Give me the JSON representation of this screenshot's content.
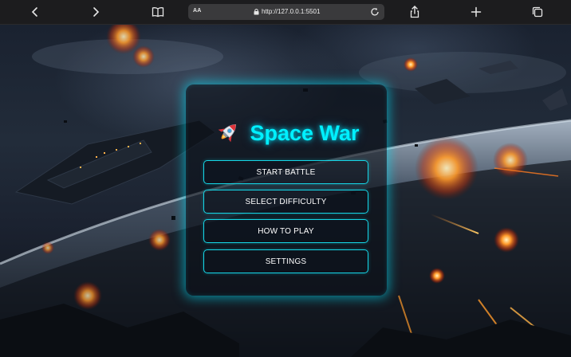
{
  "browser": {
    "address_aa": "AA",
    "url": "http://127.0.0.1:5501",
    "icons": [
      "back-icon",
      "forward-icon",
      "reader-book-icon",
      "lock-icon",
      "reload-icon",
      "share-icon",
      "new-tab-plus-icon",
      "tabs-icon"
    ]
  },
  "game": {
    "title": "Space War",
    "title_icon": "rocket-icon",
    "accent_color": "#00f0ff",
    "menu": [
      {
        "label": "START BATTLE"
      },
      {
        "label": "SELECT DIFFICULTY"
      },
      {
        "label": "HOW TO PLAY"
      },
      {
        "label": "SETTINGS"
      }
    ]
  }
}
